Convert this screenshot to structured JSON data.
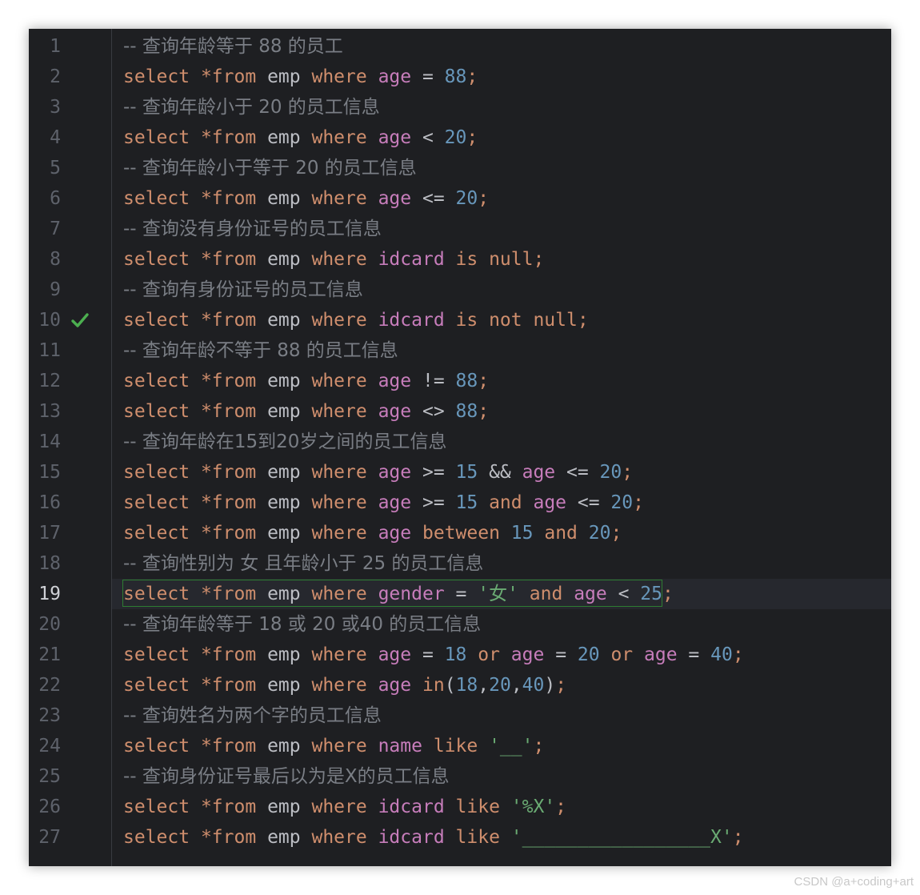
{
  "colors": {
    "background": "#1e1f22",
    "gutter_border": "#393b40",
    "line_number": "#5e626b",
    "current_line_number": "#cfd1d6",
    "current_line_bg": "#26282e",
    "comment": "#7a7e85",
    "keyword": "#cf8e6d",
    "identifier": "#bcbec4",
    "column": "#c77dbb",
    "number": "#6897bb",
    "string": "#6aab73",
    "check_mark": "#4caf50"
  },
  "gutter": {
    "current_line": 19,
    "check_line": 10,
    "check_icon": "checkmark-icon"
  },
  "lines": [
    [
      [
        "c",
        "-- 查询年龄等于 88 的员工"
      ]
    ],
    [
      [
        "k",
        "select"
      ],
      [
        "o",
        " "
      ],
      [
        "k",
        "*from"
      ],
      [
        "o",
        " "
      ],
      [
        "i",
        "emp"
      ],
      [
        "o",
        " "
      ],
      [
        "k",
        "where"
      ],
      [
        "o",
        " "
      ],
      [
        "v",
        "age"
      ],
      [
        "o",
        " = "
      ],
      [
        "n",
        "88"
      ],
      [
        "k",
        ";"
      ]
    ],
    [
      [
        "c",
        "-- 查询年龄小于 20 的员工信息"
      ]
    ],
    [
      [
        "k",
        "select"
      ],
      [
        "o",
        " "
      ],
      [
        "k",
        "*from"
      ],
      [
        "o",
        " "
      ],
      [
        "i",
        "emp"
      ],
      [
        "o",
        " "
      ],
      [
        "k",
        "where"
      ],
      [
        "o",
        " "
      ],
      [
        "v",
        "age"
      ],
      [
        "o",
        " < "
      ],
      [
        "n",
        "20"
      ],
      [
        "k",
        ";"
      ]
    ],
    [
      [
        "c",
        "-- 查询年龄小于等于 20 的员工信息"
      ]
    ],
    [
      [
        "k",
        "select"
      ],
      [
        "o",
        " "
      ],
      [
        "k",
        "*from"
      ],
      [
        "o",
        " "
      ],
      [
        "i",
        "emp"
      ],
      [
        "o",
        " "
      ],
      [
        "k",
        "where"
      ],
      [
        "o",
        " "
      ],
      [
        "v",
        "age"
      ],
      [
        "o",
        " <= "
      ],
      [
        "n",
        "20"
      ],
      [
        "k",
        ";"
      ]
    ],
    [
      [
        "c",
        "-- 查询没有身份证号的员工信息"
      ]
    ],
    [
      [
        "k",
        "select"
      ],
      [
        "o",
        " "
      ],
      [
        "k",
        "*from"
      ],
      [
        "o",
        " "
      ],
      [
        "i",
        "emp"
      ],
      [
        "o",
        " "
      ],
      [
        "k",
        "where"
      ],
      [
        "o",
        " "
      ],
      [
        "v",
        "idcard"
      ],
      [
        "o",
        " "
      ],
      [
        "k",
        "is null"
      ],
      [
        "k",
        ";"
      ]
    ],
    [
      [
        "c",
        "-- 查询有身份证号的员工信息"
      ]
    ],
    [
      [
        "k",
        "select"
      ],
      [
        "o",
        " "
      ],
      [
        "k",
        "*from"
      ],
      [
        "o",
        " "
      ],
      [
        "i",
        "emp"
      ],
      [
        "o",
        " "
      ],
      [
        "k",
        "where"
      ],
      [
        "o",
        " "
      ],
      [
        "v",
        "idcard"
      ],
      [
        "o",
        " "
      ],
      [
        "k",
        "is not null"
      ],
      [
        "k",
        ";"
      ]
    ],
    [
      [
        "c",
        "-- 查询年龄不等于 88 的员工信息"
      ]
    ],
    [
      [
        "k",
        "select"
      ],
      [
        "o",
        " "
      ],
      [
        "k",
        "*from"
      ],
      [
        "o",
        " "
      ],
      [
        "i",
        "emp"
      ],
      [
        "o",
        " "
      ],
      [
        "k",
        "where"
      ],
      [
        "o",
        " "
      ],
      [
        "v",
        "age"
      ],
      [
        "o",
        " != "
      ],
      [
        "n",
        "88"
      ],
      [
        "k",
        ";"
      ]
    ],
    [
      [
        "k",
        "select"
      ],
      [
        "o",
        " "
      ],
      [
        "k",
        "*from"
      ],
      [
        "o",
        " "
      ],
      [
        "i",
        "emp"
      ],
      [
        "o",
        " "
      ],
      [
        "k",
        "where"
      ],
      [
        "o",
        " "
      ],
      [
        "v",
        "age"
      ],
      [
        "o",
        " <> "
      ],
      [
        "n",
        "88"
      ],
      [
        "k",
        ";"
      ]
    ],
    [
      [
        "c",
        "-- 查询年龄在15到20岁之间的员工信息"
      ]
    ],
    [
      [
        "k",
        "select"
      ],
      [
        "o",
        " "
      ],
      [
        "k",
        "*from"
      ],
      [
        "o",
        " "
      ],
      [
        "i",
        "emp"
      ],
      [
        "o",
        " "
      ],
      [
        "k",
        "where"
      ],
      [
        "o",
        " "
      ],
      [
        "v",
        "age"
      ],
      [
        "o",
        " >= "
      ],
      [
        "n",
        "15"
      ],
      [
        "o",
        " && "
      ],
      [
        "v",
        "age"
      ],
      [
        "o",
        " <= "
      ],
      [
        "n",
        "20"
      ],
      [
        "k",
        ";"
      ]
    ],
    [
      [
        "k",
        "select"
      ],
      [
        "o",
        " "
      ],
      [
        "k",
        "*from"
      ],
      [
        "o",
        " "
      ],
      [
        "i",
        "emp"
      ],
      [
        "o",
        " "
      ],
      [
        "k",
        "where"
      ],
      [
        "o",
        " "
      ],
      [
        "v",
        "age"
      ],
      [
        "o",
        " >= "
      ],
      [
        "n",
        "15"
      ],
      [
        "o",
        " "
      ],
      [
        "k",
        "and"
      ],
      [
        "o",
        " "
      ],
      [
        "v",
        "age"
      ],
      [
        "o",
        " <= "
      ],
      [
        "n",
        "20"
      ],
      [
        "k",
        ";"
      ]
    ],
    [
      [
        "k",
        "select"
      ],
      [
        "o",
        " "
      ],
      [
        "k",
        "*from"
      ],
      [
        "o",
        " "
      ],
      [
        "i",
        "emp"
      ],
      [
        "o",
        " "
      ],
      [
        "k",
        "where"
      ],
      [
        "o",
        " "
      ],
      [
        "v",
        "age"
      ],
      [
        "o",
        " "
      ],
      [
        "k",
        "between"
      ],
      [
        "o",
        " "
      ],
      [
        "n",
        "15"
      ],
      [
        "o",
        " "
      ],
      [
        "k",
        "and"
      ],
      [
        "o",
        " "
      ],
      [
        "n",
        "20"
      ],
      [
        "k",
        ";"
      ]
    ],
    [
      [
        "c",
        "-- 查询性别为 女 且年龄小于 25 的员工信息"
      ]
    ],
    [
      [
        "k",
        "select"
      ],
      [
        "o",
        " "
      ],
      [
        "k",
        "*from"
      ],
      [
        "o",
        " "
      ],
      [
        "i",
        "emp"
      ],
      [
        "o",
        " "
      ],
      [
        "k",
        "where"
      ],
      [
        "o",
        " "
      ],
      [
        "v",
        "gender"
      ],
      [
        "o",
        " = "
      ],
      [
        "s",
        "'女'"
      ],
      [
        "o",
        " "
      ],
      [
        "k",
        "and"
      ],
      [
        "o",
        " "
      ],
      [
        "v",
        "age"
      ],
      [
        "o",
        " < "
      ],
      [
        "n",
        "25"
      ],
      [
        "k",
        ";"
      ]
    ],
    [
      [
        "c",
        "-- 查询年龄等于 18 或 20 或40 的员工信息"
      ]
    ],
    [
      [
        "k",
        "select"
      ],
      [
        "o",
        " "
      ],
      [
        "k",
        "*from"
      ],
      [
        "o",
        " "
      ],
      [
        "i",
        "emp"
      ],
      [
        "o",
        " "
      ],
      [
        "k",
        "where"
      ],
      [
        "o",
        " "
      ],
      [
        "v",
        "age"
      ],
      [
        "o",
        " = "
      ],
      [
        "n",
        "18"
      ],
      [
        "o",
        " "
      ],
      [
        "k",
        "or"
      ],
      [
        "o",
        " "
      ],
      [
        "v",
        "age"
      ],
      [
        "o",
        " = "
      ],
      [
        "n",
        "20"
      ],
      [
        "o",
        " "
      ],
      [
        "k",
        "or"
      ],
      [
        "o",
        " "
      ],
      [
        "v",
        "age"
      ],
      [
        "o",
        " = "
      ],
      [
        "n",
        "40"
      ],
      [
        "k",
        ";"
      ]
    ],
    [
      [
        "k",
        "select"
      ],
      [
        "o",
        " "
      ],
      [
        "k",
        "*from"
      ],
      [
        "o",
        " "
      ],
      [
        "i",
        "emp"
      ],
      [
        "o",
        " "
      ],
      [
        "k",
        "where"
      ],
      [
        "o",
        " "
      ],
      [
        "v",
        "age"
      ],
      [
        "o",
        " "
      ],
      [
        "k",
        "in"
      ],
      [
        "o",
        "("
      ],
      [
        "n",
        "18"
      ],
      [
        "o",
        ","
      ],
      [
        "n",
        "20"
      ],
      [
        "o",
        ","
      ],
      [
        "n",
        "40"
      ],
      [
        "o",
        ")"
      ],
      [
        "k",
        ";"
      ]
    ],
    [
      [
        "c",
        "-- 查询姓名为两个字的员工信息"
      ]
    ],
    [
      [
        "k",
        "select"
      ],
      [
        "o",
        " "
      ],
      [
        "k",
        "*from"
      ],
      [
        "o",
        " "
      ],
      [
        "i",
        "emp"
      ],
      [
        "o",
        " "
      ],
      [
        "k",
        "where"
      ],
      [
        "o",
        " "
      ],
      [
        "v",
        "name"
      ],
      [
        "o",
        " "
      ],
      [
        "k",
        "like"
      ],
      [
        "o",
        " "
      ],
      [
        "s",
        "'__'"
      ],
      [
        "k",
        ";"
      ]
    ],
    [
      [
        "c",
        "-- 查询身份证号最后以为是X的员工信息"
      ]
    ],
    [
      [
        "k",
        "select"
      ],
      [
        "o",
        " "
      ],
      [
        "k",
        "*from"
      ],
      [
        "o",
        " "
      ],
      [
        "i",
        "emp"
      ],
      [
        "o",
        " "
      ],
      [
        "k",
        "where"
      ],
      [
        "o",
        " "
      ],
      [
        "v",
        "idcard"
      ],
      [
        "o",
        " "
      ],
      [
        "k",
        "like"
      ],
      [
        "o",
        " "
      ],
      [
        "s",
        "'%X'"
      ],
      [
        "k",
        ";"
      ]
    ],
    [
      [
        "k",
        "select"
      ],
      [
        "o",
        " "
      ],
      [
        "k",
        "*from"
      ],
      [
        "o",
        " "
      ],
      [
        "i",
        "emp"
      ],
      [
        "o",
        " "
      ],
      [
        "k",
        "where"
      ],
      [
        "o",
        " "
      ],
      [
        "v",
        "idcard"
      ],
      [
        "o",
        " "
      ],
      [
        "k",
        "like"
      ],
      [
        "o",
        " "
      ],
      [
        "s",
        "'_________________X'"
      ],
      [
        "k",
        ";"
      ]
    ]
  ],
  "watermark": "CSDN @a+coding+art"
}
